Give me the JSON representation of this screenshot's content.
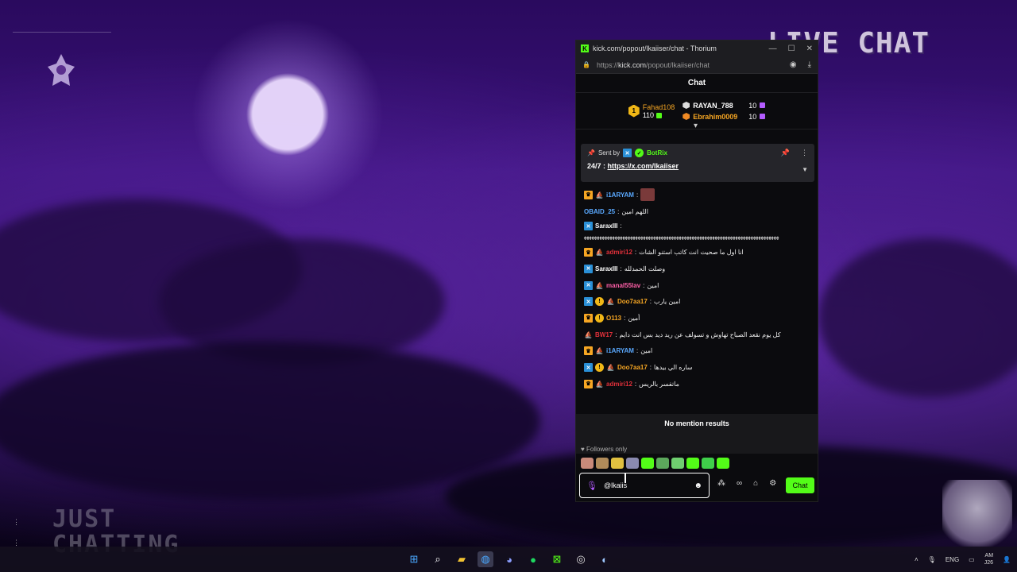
{
  "overlay": {
    "live_chat_title": "LIVE CHAT",
    "category_line1": "JUST",
    "category_line2": "CHATTING"
  },
  "window": {
    "title": "kick.com/popout/lkaiiser/chat - Thorium",
    "url_prefix": "https://",
    "url_domain": "kick.com",
    "url_path": "/popout/lkaiiser/chat"
  },
  "chat": {
    "header": "Chat",
    "leaderboard": {
      "top": {
        "rank": "1",
        "name": "Fahad108",
        "count": "110"
      },
      "others": [
        {
          "name": "RAYAN_788",
          "count": "10"
        },
        {
          "name": "Ebrahim0009",
          "count": "10"
        }
      ]
    },
    "pinned": {
      "sent_by_label": "Sent by",
      "bot_name": "BotRix",
      "message_prefix": "24/7 : ",
      "link": "https://x.com/lkaiiser"
    },
    "messages": [
      {
        "user": "i1ARYAM",
        "color": "#5aa9ff",
        "badges": [
          "crown",
          "ship"
        ],
        "text": ""
      },
      {
        "user": "OBAID_25",
        "color": "#5aa9ff",
        "badges": [],
        "text": "اللهم امين"
      },
      {
        "user": "SaraxIII",
        "color": "#ffffff",
        "badges": [
          "kick"
        ],
        "text": "ﻬﻬﻬﻬﻬﻬﻬﻬﻬﻬﻬﻬﻬﻬﻬﻬﻬﻬﻬﻬﻬﻬﻬﻬﻬﻬﻬﻬﻬﻬﻬﻬﻬﻬﻬﻬﻬﻬﻬﻬﻬﻬﻬﻬﻬﻬﻬﻬﻬﻬﻬﻬﻬﻬﻬﻬﻬﻬﻬﻬﻬﻬﻬﻬﻬﻬﻬﻬﻬﻬﻬﻬﻬﻬﻬﻬ"
      },
      {
        "user": "admiri12",
        "color": "#e0303a",
        "badges": [
          "crown",
          "ship"
        ],
        "text": "انا اول ما صحيت انت كاتب استنو الشات"
      },
      {
        "user": "SaraxIII",
        "color": "#ffffff",
        "badges": [
          "kick"
        ],
        "text": "وصلت الحمدلله"
      },
      {
        "user": "manal55lav",
        "color": "#ff5fa8",
        "badges": [
          "kick",
          "ship"
        ],
        "text": "امين"
      },
      {
        "user": "Doo7aa17",
        "color": "#f6a623",
        "badges": [
          "kick",
          "coin",
          "ship"
        ],
        "text": "امين يارب"
      },
      {
        "user": "O113",
        "color": "#f6a623",
        "badges": [
          "crown",
          "coin"
        ],
        "text": "أمين"
      },
      {
        "user": "BW17",
        "color": "#e0303a",
        "badges": [
          "ship"
        ],
        "text": "كل يوم نقعد الصباح تهاوش و تسولف عن ريد ديد بس انت دايم"
      },
      {
        "user": "i1ARYAM",
        "color": "#5aa9ff",
        "badges": [
          "crown",
          "ship"
        ],
        "text": "امين"
      },
      {
        "user": "Doo7aa17",
        "color": "#f6a623",
        "badges": [
          "kick",
          "coin",
          "ship"
        ],
        "text": "ساره الي بيدها"
      },
      {
        "user": "admiri12",
        "color": "#e0303a",
        "badges": [
          "crown",
          "ship"
        ],
        "text": "ماتفسر بالريس"
      }
    ],
    "mention_results": "No mention results",
    "followers_only": "Followers only",
    "input_value": "@lkaiis",
    "send_label": "Chat"
  },
  "taskbar": {
    "language": "ENG",
    "clock_time": "AM",
    "clock_date": "J26"
  },
  "colors": {
    "kick_green": "#53fc18",
    "panel_bg": "#0b0b0e",
    "accent_purple": "#b45cff"
  }
}
